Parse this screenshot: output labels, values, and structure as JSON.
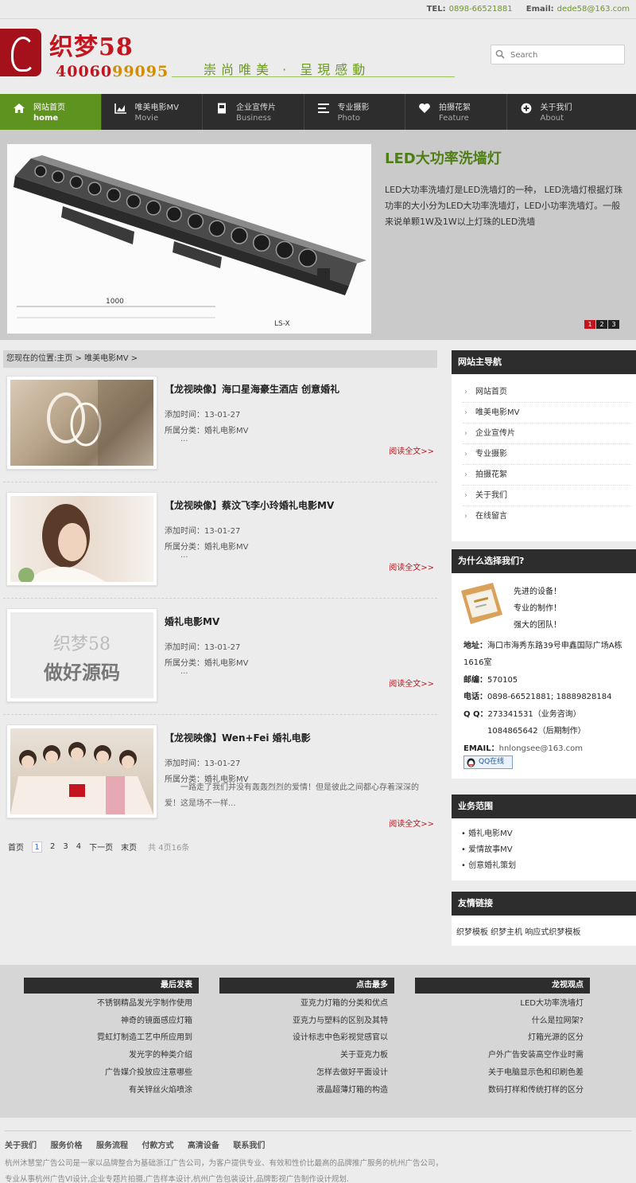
{
  "topbar": {
    "tel_label": "TEL:",
    "tel_value": "0898-66521881",
    "email_label": "Email:",
    "email_value": "dede58@163.com"
  },
  "header": {
    "logo_title": "织梦58",
    "logo_phone_main": "40060",
    "logo_phone_tail": "99095",
    "slogan": "崇尚唯美 · 呈現感動",
    "search_placeholder": "Search"
  },
  "nav": [
    {
      "label": "网站首页",
      "sub": "home",
      "icon": "home-icon",
      "active": true
    },
    {
      "label": "唯美电影MV",
      "sub": "Movie",
      "icon": "chart-icon",
      "active": false
    },
    {
      "label": "企业宣传片",
      "sub": "Business",
      "icon": "document-icon",
      "active": false
    },
    {
      "label": "专业摄影",
      "sub": "Photo",
      "icon": "list-icon",
      "active": false
    },
    {
      "label": "拍摄花絮",
      "sub": "Feature",
      "icon": "heart-icon",
      "active": false
    },
    {
      "label": "关于我们",
      "sub": "About",
      "icon": "plus-circle-icon",
      "active": false
    }
  ],
  "banner": {
    "title": "LED大功率洗墙灯",
    "text": "LED大功率洗墙灯是LED洗墙灯的一种， LED洗墙灯根据灯珠功率的大小分为LED大功率洗墙灯，LED小功率洗墙灯。一般来说单颗1W及1W以上灯珠的LED洗墙",
    "image_caption_dim": "1000",
    "image_caption_model": "LS-X",
    "pager": [
      "1",
      "2",
      "3"
    ]
  },
  "breadcrumb": {
    "text": "您现在的位置:主页 > 唯美电影MV >"
  },
  "articles": [
    {
      "title": "【龙视映像】海口星海豪生酒店 创意婚礼",
      "time": "添加时间：13-01-27",
      "category": "所属分类：婚礼电影MV",
      "summary": "...",
      "more": "阅读全文>>"
    },
    {
      "title": "【龙视映像】蔡汶飞李小玲婚礼电影MV",
      "time": "添加时间：13-01-27",
      "category": "所属分类：婚礼电影MV",
      "summary": "...",
      "more": "阅读全文>>"
    },
    {
      "title": "婚礼电影MV",
      "time": "添加时间：13-01-27",
      "category": "所属分类：婚礼电影MV",
      "summary": "...",
      "more": "阅读全文>>",
      "placeholder_line1": "织梦58",
      "placeholder_line2": "做好源码"
    },
    {
      "title": "【龙视映像】Wen+Fei 婚礼电影",
      "time": "添加时间：13-01-27",
      "category": "所属分类：婚礼电影MV",
      "summary": "一路走了我们并没有轰轰烈烈的爱情！但是彼此之间都心存着深深的爱！这是场不一样...",
      "more": "阅读全文>>"
    }
  ],
  "pagination": {
    "first": "首页",
    "pages": [
      "1",
      "2",
      "3",
      "4"
    ],
    "next": "下一页",
    "last": "末页",
    "total": "共 4页16条"
  },
  "sidebar": {
    "nav_title": "网站主导航",
    "nav_items": [
      "网站首页",
      "唯美电影MV",
      "企业宣传片",
      "专业摄影",
      "拍摄花絮",
      "关于我们",
      "在线留言"
    ],
    "why_title": "为什么选择我们?",
    "why_points": [
      "先进的设备！",
      "专业的制作！",
      "强大的团队！"
    ],
    "address_label": "地址：",
    "address_value": "海口市海秀东路39号申鑫国际广场A栋1616室",
    "zip_label": "邮编：",
    "zip_value": "570105",
    "phone_label": "电话：",
    "phone_value": "0898-66521881; 18889828184",
    "qq_label": "Q  Q：",
    "qq_1": "273341531（业务咨询）",
    "qq_2": "1084865642（后期制作）",
    "email_label": "EMAIL：",
    "email_value": "hnlongsee@163.com",
    "qq_online": "QQ在线",
    "scope_title": "业务范围",
    "scope_items": [
      "婚礼电影MV",
      "爱情故事MV",
      "创意婚礼策划"
    ],
    "links_title": "友情链接",
    "links_text": "织梦模板 织梦主机 响应式织梦模板"
  },
  "footer_cols": [
    {
      "title": "最后发表",
      "items": [
        "不锈钢精品发光字制作使用",
        "神奇的镜面感应灯箱",
        "霓虹灯制造工艺中所应用到",
        "发光字的种类介绍",
        "广告媒介投放应注意哪些",
        "有关锌丝火焰喷涂"
      ]
    },
    {
      "title": "点击最多",
      "items": [
        "亚克力灯箱的分类和优点",
        "亚克力与塑料的区别及其特",
        "设计标志中色彩视觉感官以",
        "关于亚克力板",
        "怎样去做好平面设计",
        "液晶超薄灯箱的构造"
      ]
    },
    {
      "title": "龙视观点",
      "items": [
        "LED大功率洗墙灯",
        "什么是拉网架?",
        "灯箱光源的区分",
        "户外广告安装高空作业时需",
        "关于电脑显示色和印刷色差",
        "数码打样和传统打样的区分"
      ]
    }
  ],
  "bottom": {
    "links": [
      "关于我们",
      "服务价格",
      "服务流程",
      "付款方式",
      "高清设备",
      "联系我们"
    ],
    "text_1": "杭州沐慧堂广告公司是一家以品牌整合为基础浙江广告公司，为客户提供专业、有效和性价比最高的品牌推广服务的杭州广告公司，",
    "text_2": "专业从事杭州广告VI设计,企业专题片拍摄,广告样本设计,杭州广告包装设计,品牌影视广告制作设计规划."
  }
}
